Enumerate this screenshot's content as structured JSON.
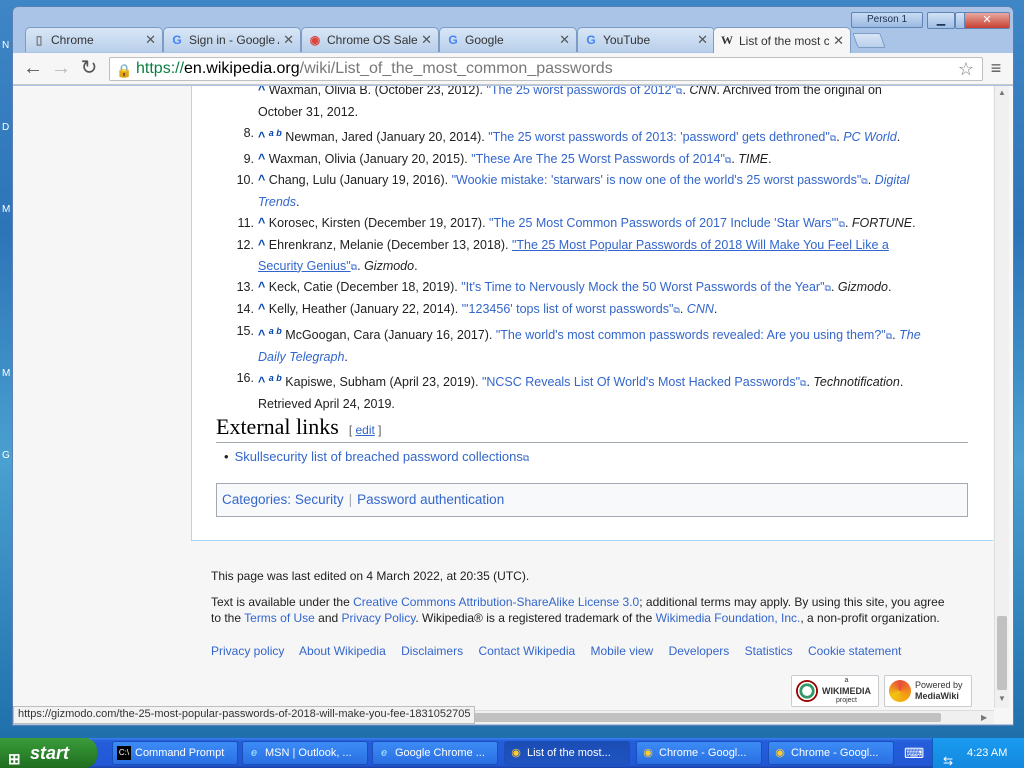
{
  "desktop": {
    "letters": [
      "N",
      "D",
      "M",
      "M",
      "G"
    ]
  },
  "window": {
    "profile": "Person 1",
    "controls": {
      "minimize": "▁",
      "maximize": "□",
      "close": "✕"
    }
  },
  "tabs": [
    {
      "label": "Chrome",
      "icon": "page-icon"
    },
    {
      "label": "Sign in - Google Acc",
      "icon": "google-icon"
    },
    {
      "label": "Chrome OS Sales",
      "icon": "chrome-icon"
    },
    {
      "label": "Google",
      "icon": "google-icon"
    },
    {
      "label": "YouTube",
      "icon": "google-icon"
    },
    {
      "label": "List of the most co",
      "icon": "wikipedia-icon"
    }
  ],
  "toolbar": {
    "back": "←",
    "forward": "→",
    "reload": "↻",
    "menu": "≡",
    "star": "☆",
    "url_scheme": "https://",
    "url_host": "en.wikipedia.org",
    "url_path": "/wiki/List_of_the_most_common_passwords"
  },
  "refs": [
    {
      "num": "",
      "text_a": "Waxman, Olivia B. (October 23, 2012). ",
      "link": "\"The 25 worst passwords of 2012\"",
      "text_b": ". ",
      "source": "CNN",
      "text_c": ". Archived from the original on",
      "cont": "October 31, 2012."
    },
    {
      "num": "8.",
      "sup": "a b",
      "text_a": "Newman, Jared (January 20, 2014). ",
      "link": "\"The 25 worst passwords of 2013: 'password' gets dethroned\"",
      "text_b": ". ",
      "source": "PC World",
      "text_c": "."
    },
    {
      "num": "9.",
      "text_a": "Waxman, Olivia (January 20, 2015). ",
      "link": "\"These Are The 25 Worst Passwords of 2014\"",
      "text_b": ". ",
      "source": "TIME",
      "text_c": "."
    },
    {
      "num": "10.",
      "text_a": "Chang, Lulu (January 19, 2016). ",
      "link": "\"Wookie mistake: 'starwars' is now one of the world's 25 worst passwords\"",
      "text_b": ". ",
      "source": "Digital",
      "cont_source": "Trends",
      "text_c": "."
    },
    {
      "num": "11.",
      "text_a": "Korosec, Kirsten (December 19, 2017). ",
      "link": "\"The 25 Most Common Passwords of 2017 Include 'Star Wars'\"",
      "text_b": ". ",
      "source": "FORTUNE",
      "text_c": "."
    },
    {
      "num": "12.",
      "text_a": "Ehrenkranz, Melanie (December 13, 2018). ",
      "link": "\"The 25 Most Popular Passwords of 2018 Will Make You Feel Like a",
      "link_cont": "Security Genius\"",
      "text_b": ". ",
      "source": "Gizmodo",
      "text_c": "."
    },
    {
      "num": "13.",
      "text_a": "Keck, Catie (December 18, 2019). ",
      "link": "\"It's Time to Nervously Mock the 50 Worst Passwords of the Year\"",
      "text_b": ". ",
      "source": "Gizmodo",
      "text_c": "."
    },
    {
      "num": "14.",
      "text_a": "Kelly, Heather (January 22, 2014). ",
      "link": "\"'123456' tops list of worst passwords\"",
      "text_b": ". ",
      "source": "CNN",
      "text_c": "."
    },
    {
      "num": "15.",
      "sup": "a b",
      "text_a": "McGoogan, Cara (January 16, 2017). ",
      "link": "\"The world's most common passwords revealed: Are you using them?\"",
      "text_b": ". ",
      "source": "The",
      "cont_source": "Daily Telegraph",
      "text_c": "."
    },
    {
      "num": "16.",
      "sup": "a b",
      "text_a": "Kapiswe, Subham (April 23, 2019). ",
      "link": "\"NCSC Reveals List Of World's Most Hacked Passwords\"",
      "text_b": ". ",
      "source": "Technotification",
      "text_c": ".",
      "cont": "Retrieved April 24, 2019."
    }
  ],
  "caret": "^",
  "external_links": {
    "heading": "External links",
    "edit_open": "[ ",
    "edit_label": "edit",
    "edit_close": " ]",
    "items": [
      "Skullsecurity list of breached password collections"
    ]
  },
  "categories": {
    "label": "Categories:",
    "items": [
      "Security",
      "Password authentication"
    ]
  },
  "footer": {
    "last_edited": "This page was last edited on 4 March 2022, at 20:35 (UTC).",
    "license_a": "Text is available under the ",
    "license_link": "Creative Commons Attribution-ShareAlike License 3.0",
    "license_b": "; additional terms may apply. By using this site, you agree",
    "license_c": "to the ",
    "terms": "Terms of Use",
    "and": " and ",
    "privacy": "Privacy Policy",
    "license_d": ". Wikipedia® is a registered trademark of the ",
    "foundation": "Wikimedia Foundation, Inc.",
    "license_e": ", a non-profit organization.",
    "links": [
      "Privacy policy",
      "About Wikipedia",
      "Disclaimers",
      "Contact Wikipedia",
      "Mobile view",
      "Developers",
      "Statistics",
      "Cookie statement"
    ],
    "badge_wikimedia_top": "a",
    "badge_wikimedia": "WIKIMEDIA",
    "badge_wikimedia_sub": "project",
    "badge_mediawiki_top": "Powered by",
    "badge_mediawiki": "MediaWiki"
  },
  "status_url": "https://gizmodo.com/the-25-most-popular-passwords-of-2018-will-make-you-fee-1831052705",
  "taskbar": {
    "start": "start",
    "tasks": [
      {
        "label": "Command Prompt",
        "icon": "cmd-icon"
      },
      {
        "label": "MSN | Outlook, ...",
        "icon": "ie-icon"
      },
      {
        "label": "Google Chrome ...",
        "icon": "ie-icon"
      },
      {
        "label": "List of the most...",
        "icon": "chrome-icon"
      },
      {
        "label": "Chrome - Googl...",
        "icon": "chrome-icon"
      },
      {
        "label": "Chrome - Googl...",
        "icon": "chrome-icon"
      }
    ],
    "clock": "4:23 AM"
  },
  "colors": {
    "link": "#3366cc",
    "secure": "#0b8043",
    "taskbar": "#245edb",
    "start": "#2f8a2f"
  }
}
